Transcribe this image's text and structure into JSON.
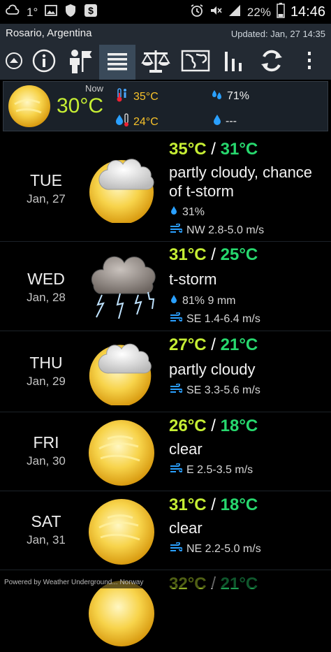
{
  "status": {
    "signal_text": "1°",
    "battery": "22%",
    "time": "14:46"
  },
  "header": {
    "location": "Rosario, Argentina",
    "updated": "Updated: Jan, 27 14:35"
  },
  "toolbar": {
    "icons": [
      "collapse-icon",
      "info-icon",
      "person-flag-icon",
      "list-icon",
      "scale-icon",
      "map-icon",
      "bar-chart-icon",
      "refresh-icon",
      "overflow-menu-icon"
    ],
    "active": "list-icon"
  },
  "current": {
    "now_label": "Now",
    "temp": "30°C",
    "max": "35°C",
    "min": "24°C",
    "humidity": "71%",
    "precip": "---"
  },
  "days": [
    {
      "name": "TUE",
      "date": "Jan, 27",
      "hi": "35°C",
      "lo": "31°C",
      "cond": "partly cloudy, chance of t-storm",
      "precip": "31%",
      "wind": "NW 2.8-5.0 m/s",
      "icon": "partly-cloudy-icon"
    },
    {
      "name": "WED",
      "date": "Jan, 28",
      "hi": "31°C",
      "lo": "25°C",
      "cond": "t-storm",
      "precip": "81% 9 mm",
      "wind": "SE 1.4-6.4 m/s",
      "icon": "thunderstorm-icon"
    },
    {
      "name": "THU",
      "date": "Jan, 29",
      "hi": "27°C",
      "lo": "21°C",
      "cond": "partly cloudy",
      "wind": "SE 3.3-5.6 m/s",
      "icon": "partly-cloudy-icon"
    },
    {
      "name": "FRI",
      "date": "Jan, 30",
      "hi": "26°C",
      "lo": "18°C",
      "cond": "clear",
      "wind": "E 2.5-3.5 m/s",
      "icon": "sun-icon"
    },
    {
      "name": "SAT",
      "date": "Jan, 31",
      "hi": "31°C",
      "lo": "18°C",
      "cond": "clear",
      "wind": "NE 2.2-5.0 m/s",
      "icon": "sun-icon"
    },
    {
      "name": "",
      "date": "",
      "hi": "32°C",
      "lo": "21°C",
      "cond": "",
      "wind": "",
      "icon": "sun-icon"
    }
  ],
  "footer": "Powered by Weather Underground... Norway",
  "colors": {
    "hi": "#c6ee34",
    "lo": "#27d86e",
    "appbar": "#232a33"
  }
}
